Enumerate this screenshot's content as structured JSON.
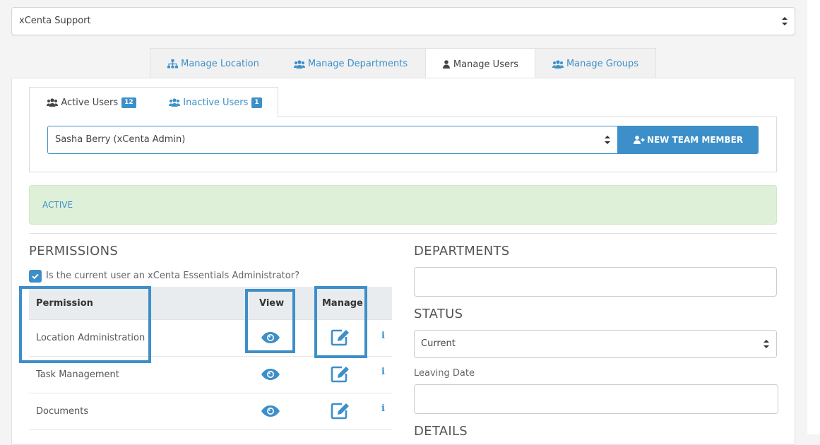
{
  "org_select": {
    "value": "xCenta Support"
  },
  "top_tabs": [
    {
      "label": "Manage Location",
      "icon": "sitemap-icon"
    },
    {
      "label": "Manage Departments",
      "icon": "users-icon"
    },
    {
      "label": "Manage Users",
      "icon": "user-icon",
      "active": true
    },
    {
      "label": "Manage Groups",
      "icon": "users-icon"
    }
  ],
  "sub_tabs": {
    "active_users": {
      "label": "Active Users",
      "count": "12"
    },
    "inactive_users": {
      "label": "Inactive Users",
      "count": "1"
    }
  },
  "user_select": {
    "value": "Sasha Berry (xCenta Admin)"
  },
  "new_member_button": {
    "label": "NEW TEAM MEMBER"
  },
  "status_alert": {
    "text": "ACTIVE"
  },
  "permissions": {
    "title": "PERMISSIONS",
    "admin_checkbox_label": "Is the current user an xCenta Essentials Administrator?",
    "admin_checked": true,
    "headers": {
      "permission": "Permission",
      "view": "View",
      "manage": "Manage"
    },
    "rows": [
      {
        "label": "Location Administration"
      },
      {
        "label": "Task Management"
      },
      {
        "label": "Documents"
      }
    ]
  },
  "departments": {
    "title": "DEPARTMENTS"
  },
  "status": {
    "title": "STATUS",
    "value": "Current",
    "leaving_date_label": "Leaving Date"
  },
  "details": {
    "title": "DETAILS"
  },
  "colors": {
    "accent": "#3d8fc9",
    "alert_bg": "#dff0d8",
    "header_bg": "#e9ecef"
  }
}
